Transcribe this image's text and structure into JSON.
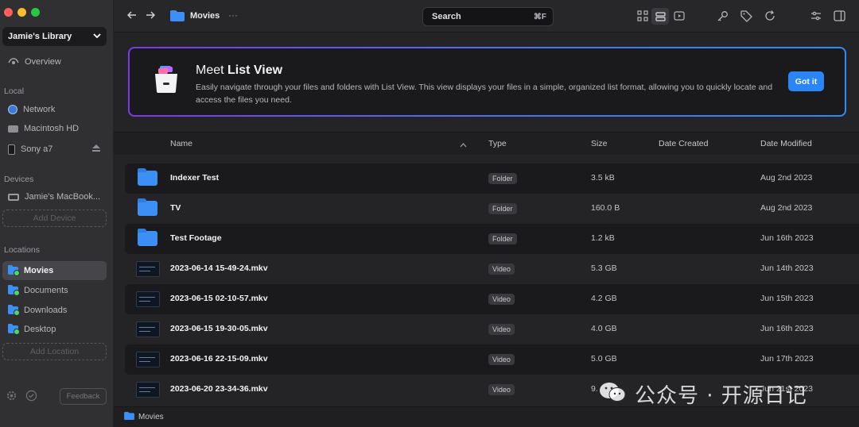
{
  "sidebar": {
    "library": "Jamie's Library",
    "overview": "Overview",
    "local_heading": "Local",
    "local": [
      "Network",
      "Macintosh HD",
      "Sony a7"
    ],
    "devices_heading": "Devices",
    "device": "Jamie's MacBook...",
    "add_device": "Add Device",
    "locations_heading": "Locations",
    "locations": [
      "Movies",
      "Documents",
      "Downloads",
      "Desktop"
    ],
    "add_location": "Add Location",
    "feedback": "Feedback"
  },
  "toolbar": {
    "title": "Movies",
    "search_label": "Search",
    "search_kbd": "⌘F",
    "more": "···"
  },
  "banner": {
    "title_prefix": "Meet ",
    "title_bold": "List View",
    "description": "Easily navigate through your files and folders with List View. This view displays your files in a simple, organized list format, allowing you to quickly locate and access the files you need.",
    "button": "Got it"
  },
  "table": {
    "headers": {
      "name": "Name",
      "type": "Type",
      "size": "Size",
      "created": "Date Created",
      "modified": "Date Modified"
    },
    "rows": [
      {
        "name": "Indexer Test",
        "type": "Folder",
        "size": "3.5 kB",
        "modified": "Aug 2nd 2023"
      },
      {
        "name": "TV",
        "type": "Folder",
        "size": "160.0 B",
        "modified": "Aug 2nd 2023"
      },
      {
        "name": "Test Footage",
        "type": "Folder",
        "size": "1.2 kB",
        "modified": "Jun 16th 2023"
      },
      {
        "name": "2023-06-14 15-49-24.mkv",
        "type": "Video",
        "size": "5.3 GB",
        "modified": "Jun 14th 2023"
      },
      {
        "name": "2023-06-15 02-10-57.mkv",
        "type": "Video",
        "size": "4.2 GB",
        "modified": "Jun 15th 2023"
      },
      {
        "name": "2023-06-15 19-30-05.mkv",
        "type": "Video",
        "size": "4.0 GB",
        "modified": "Jun 16th 2023"
      },
      {
        "name": "2023-06-16 22-15-09.mkv",
        "type": "Video",
        "size": "5.0 GB",
        "modified": "Jun 17th 2023"
      },
      {
        "name": "2023-06-20 23-34-36.mkv",
        "type": "Video",
        "size": "9.",
        "modified": "Jun 21st 2023"
      }
    ]
  },
  "footer": {
    "path": "Movies"
  },
  "watermark": "公众号 · 开源日记",
  "colors": {
    "accent": "#2a86f7",
    "folder": "#3b8ff5"
  }
}
